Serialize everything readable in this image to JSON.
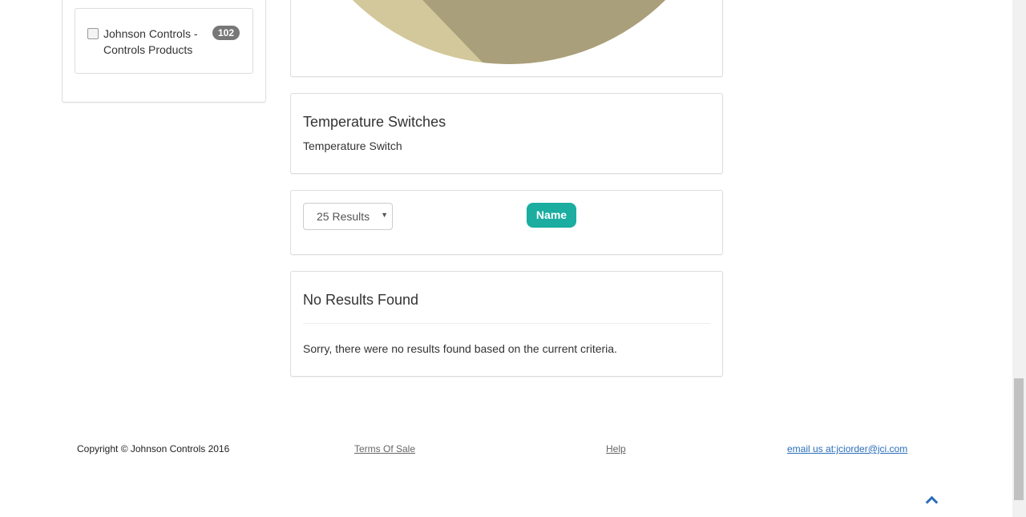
{
  "sidebar": {
    "filter_label": "Johnson Controls - Controls Products",
    "filter_count": "102"
  },
  "category": {
    "title": "Temperature Switches",
    "subtitle": "Temperature Switch"
  },
  "controls": {
    "page_size": "25 Results",
    "sort_button": "Name"
  },
  "results": {
    "title": "No Results Found",
    "message": "Sorry, there were no results found based on the current criteria."
  },
  "footer": {
    "copyright": "Copyright © Johnson Controls 2016",
    "terms": "Terms Of Sale",
    "help": "Help",
    "email": "email us at:jciorder@jci.com"
  },
  "colors": {
    "accent": "#1aada0",
    "pie_light": "#d3c89b",
    "pie_dark": "#aa9f7b"
  }
}
